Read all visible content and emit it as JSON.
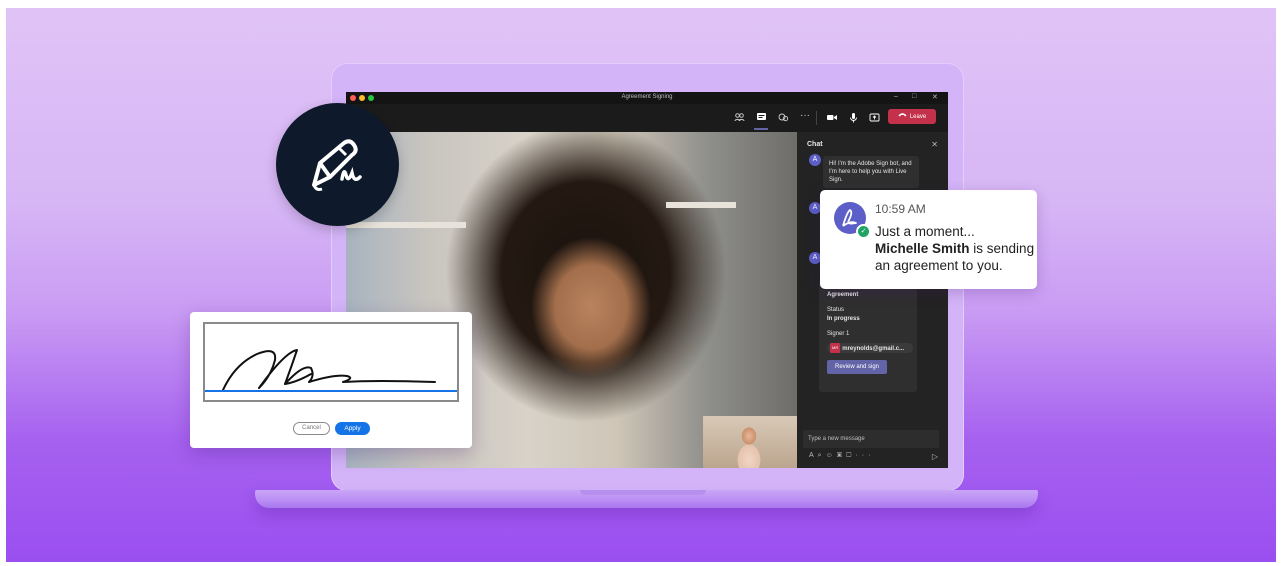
{
  "window": {
    "title": "Agreement Signing",
    "min": "–",
    "max": "□",
    "close": "✕"
  },
  "toolbar": {
    "leave_label": "Leave",
    "icons": [
      "people-icon",
      "chat-icon",
      "apps-icon",
      "more-icon",
      "camera-icon",
      "mic-icon",
      "share-icon",
      "phone-icon"
    ]
  },
  "chat": {
    "header": "Chat",
    "bot_message": "Hi! I'm the Adobe Sign bot, and I'm here to help you with Live Sign.",
    "card": {
      "heading": "Agreement",
      "status_label": "Status",
      "status_value": "In progress",
      "signer_label": "Signer 1",
      "signer_initials": "MR",
      "signer_email": "mreynolds@gmail.c...",
      "review_label": "Review and sign"
    },
    "compose_placeholder": "Type a new message"
  },
  "notification": {
    "time": "10:59 AM",
    "line1": "Just a moment...",
    "name": "Michelle Smith",
    "line2_suffix": " is sending",
    "line3": "an agreement to you."
  },
  "signature_pad": {
    "cancel_label": "Cancel",
    "apply_label": "Apply"
  },
  "colors": {
    "background_top": "#e0c3f6",
    "background_bottom": "#9a4ff0",
    "leave_red": "#c4314b",
    "teams_purple": "#6264a7",
    "apply_blue": "#1473e6",
    "badge_navy": "#0e1a2b",
    "check_green": "#21a366"
  }
}
